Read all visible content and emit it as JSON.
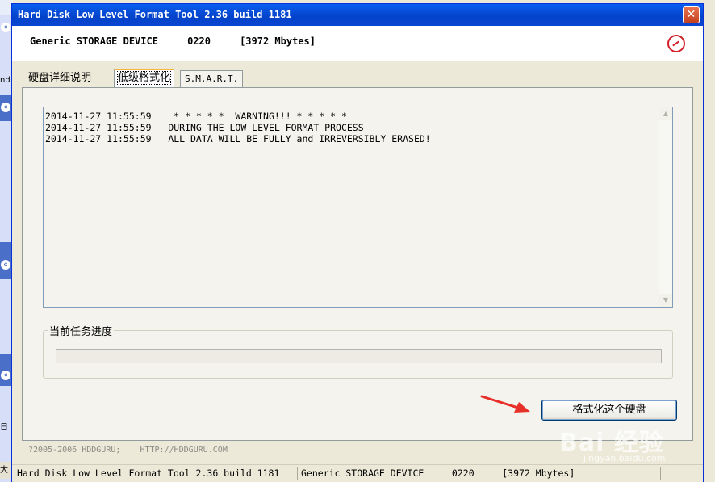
{
  "window": {
    "title": "Hard Disk Low Level Format Tool 2.36 build 1181",
    "close_glyph": "✕"
  },
  "device": {
    "info": "Generic STORAGE DEVICE     0220     [3972 Mbytes]"
  },
  "tabs": [
    {
      "label": "硬盘详细说明"
    },
    {
      "label": "低级格式化"
    },
    {
      "label": "S.M.A.R.T."
    }
  ],
  "log": {
    "lines": [
      "2014-11-27 11:55:59    * * * * *  WARNING!!! * * * * *",
      "2014-11-27 11:55:59   DURING THE LOW LEVEL FORMAT PROCESS",
      "2014-11-27 11:55:59   ALL DATA WILL BE FULLY and IRREVERSIBLY ERASED!"
    ]
  },
  "progress": {
    "label": "当前任务进度",
    "value": 0
  },
  "buttons": {
    "format_label": "格式化这个硬盘"
  },
  "footer": {
    "copyright": "?2005-2006 HDDGURU;    HTTP://HDDGURU.COM"
  },
  "statusbar": {
    "app": "Hard Disk Low Level Format Tool 2.36 build 1181",
    "device": "Generic STORAGE DEVICE     0220     [3972 Mbytes]"
  },
  "background": {
    "left_frag_1": "nd",
    "left_frag_2": "日",
    "left_frag_3": "大"
  },
  "watermark": {
    "main": "Bai 经验",
    "sub": "jingyan.baidu.com"
  },
  "colors": {
    "titlebar": "#0442C9",
    "progress_fill": "#2FB332",
    "arrow": "#E8302A",
    "logo": "#D2202B"
  }
}
